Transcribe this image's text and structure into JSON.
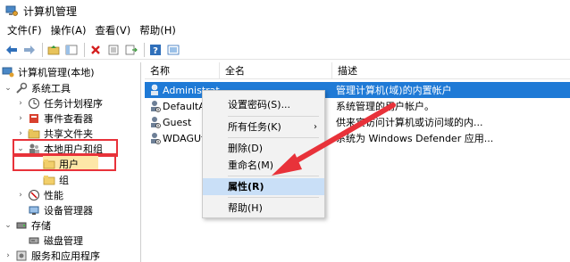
{
  "window": {
    "title": "计算机管理"
  },
  "menu": [
    "文件(F)",
    "操作(A)",
    "查看(V)",
    "帮助(H)"
  ],
  "tree": {
    "root": "计算机管理(本地)",
    "system_tools": "系统工具",
    "task_scheduler": "任务计划程序",
    "event_viewer": "事件查看器",
    "shared_folders": "共享文件夹",
    "local_users_groups": "本地用户和组",
    "users": "用户",
    "groups": "组",
    "performance": "性能",
    "device_manager": "设备管理器",
    "storage": "存储",
    "disk_management": "磁盘管理",
    "services_apps": "服务和应用程序"
  },
  "list": {
    "columns": [
      "名称",
      "全名",
      "描述"
    ],
    "rows": [
      {
        "name": "Administrat...",
        "fullname": "",
        "desc": "管理计算机(域)的内置帐户",
        "selected": true
      },
      {
        "name": "DefaultAc",
        "fullname": "",
        "desc": "系统管理的用户帐户。",
        "selected": false
      },
      {
        "name": "Guest",
        "fullname": "",
        "desc": "供来宾访问计算机或访问域的内...",
        "selected": false
      },
      {
        "name": "WDAGUt",
        "fullname": "",
        "desc": "系统为 Windows Defender 应用...",
        "selected": false
      }
    ]
  },
  "context_menu": {
    "set_password": "设置密码(S)...",
    "all_tasks": "所有任务(K)",
    "delete": "删除(D)",
    "rename": "重命名(M)",
    "properties": "属性(R)",
    "help": "帮助(H)"
  },
  "colors": {
    "selection": "#1f7ad6",
    "highlight_box": "#e8323a",
    "arrow": "#e8323a"
  }
}
